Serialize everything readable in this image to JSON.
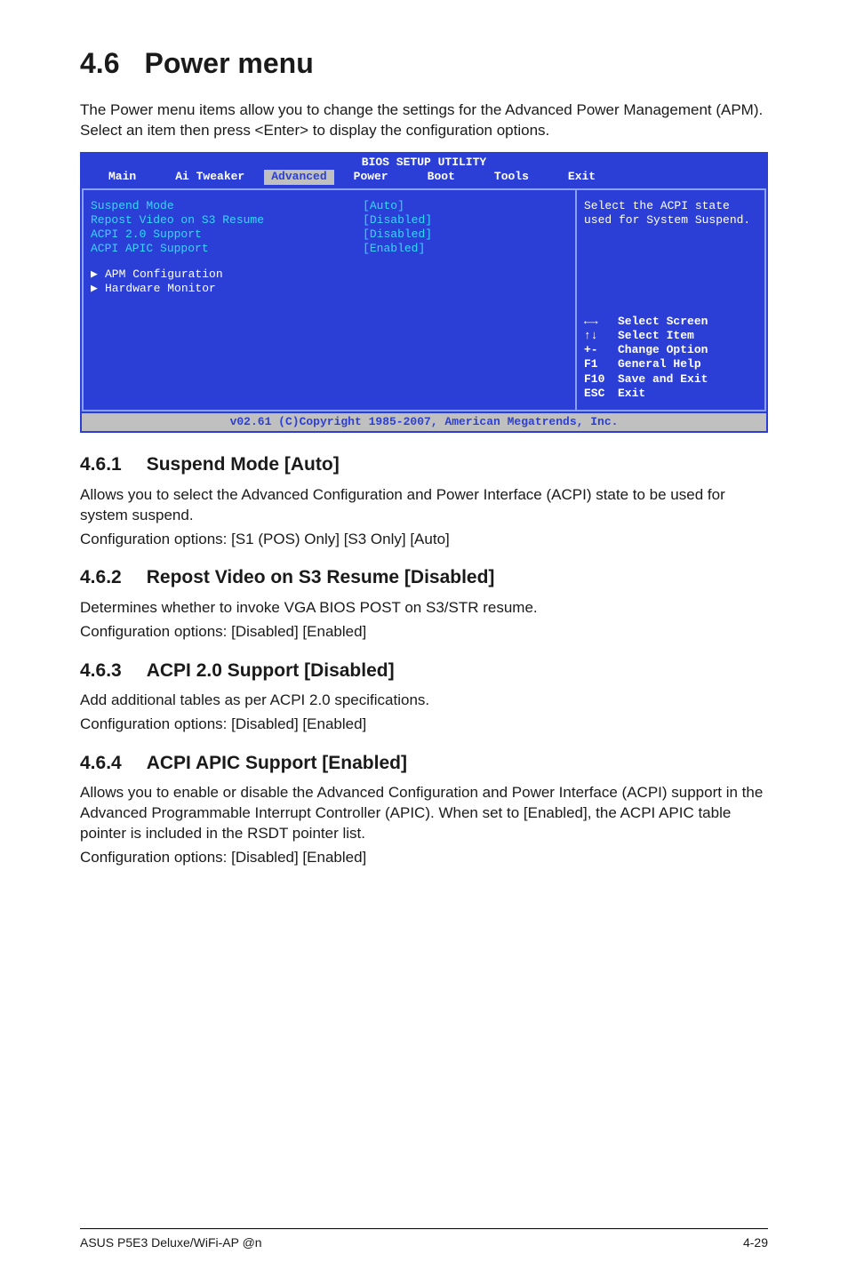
{
  "heading": {
    "number": "4.6",
    "title": "Power menu"
  },
  "intro": "The Power menu items allow you to change the settings for the Advanced Power Management (APM). Select an item then press <Enter> to display the configuration options.",
  "bios": {
    "title": "BIOS SETUP UTILITY",
    "tabs": [
      "Main",
      "Ai Tweaker",
      "Advanced",
      "Power",
      "Boot",
      "Tools",
      "Exit"
    ],
    "active_tab": "Advanced",
    "rows": [
      {
        "label": "Suspend Mode",
        "value": "[Auto]"
      },
      {
        "label": "Repost Video on S3 Resume",
        "value": "[Disabled]"
      },
      {
        "label": "ACPI 2.0 Support",
        "value": "[Disabled]"
      },
      {
        "label": "ACPI APIC Support",
        "value": "[Enabled]"
      }
    ],
    "submenus": [
      "APM Configuration",
      "Hardware Monitor"
    ],
    "help": "Select the ACPI state used for System Suspend.",
    "keys": [
      {
        "k": "←→",
        "d": "Select Screen"
      },
      {
        "k": "↑↓",
        "d": "Select Item"
      },
      {
        "k": "+-",
        "d": "Change Option"
      },
      {
        "k": "F1",
        "d": "General Help"
      },
      {
        "k": "F10",
        "d": "Save and Exit"
      },
      {
        "k": "ESC",
        "d": "Exit"
      }
    ],
    "footer": "v02.61 (C)Copyright 1985-2007, American Megatrends, Inc."
  },
  "sections": [
    {
      "num": "4.6.1",
      "title": "Suspend Mode [Auto]",
      "body": [
        "Allows you to select the Advanced Configuration and Power Interface (ACPI) state to be used for system suspend.",
        "Configuration options: [S1 (POS) Only] [S3 Only] [Auto]"
      ]
    },
    {
      "num": "4.6.2",
      "title": "Repost Video on S3 Resume [Disabled]",
      "body": [
        "Determines whether to invoke VGA BIOS POST on S3/STR resume.",
        "Configuration options: [Disabled] [Enabled]"
      ]
    },
    {
      "num": "4.6.3",
      "title": "ACPI 2.0 Support [Disabled]",
      "body": [
        "Add additional tables as per ACPI 2.0 specifications.",
        "Configuration options: [Disabled] [Enabled]"
      ]
    },
    {
      "num": "4.6.4",
      "title": "ACPI APIC Support [Enabled]",
      "body": [
        "Allows you to enable or disable the Advanced Configuration and Power Interface (ACPI) support in the Advanced Programmable Interrupt Controller (APIC). When set to [Enabled], the ACPI APIC table pointer is included in the RSDT pointer list.",
        "Configuration options: [Disabled] [Enabled]"
      ]
    }
  ],
  "pagefooter": {
    "left": "ASUS P5E3 Deluxe/WiFi-AP @n",
    "right": "4-29"
  }
}
